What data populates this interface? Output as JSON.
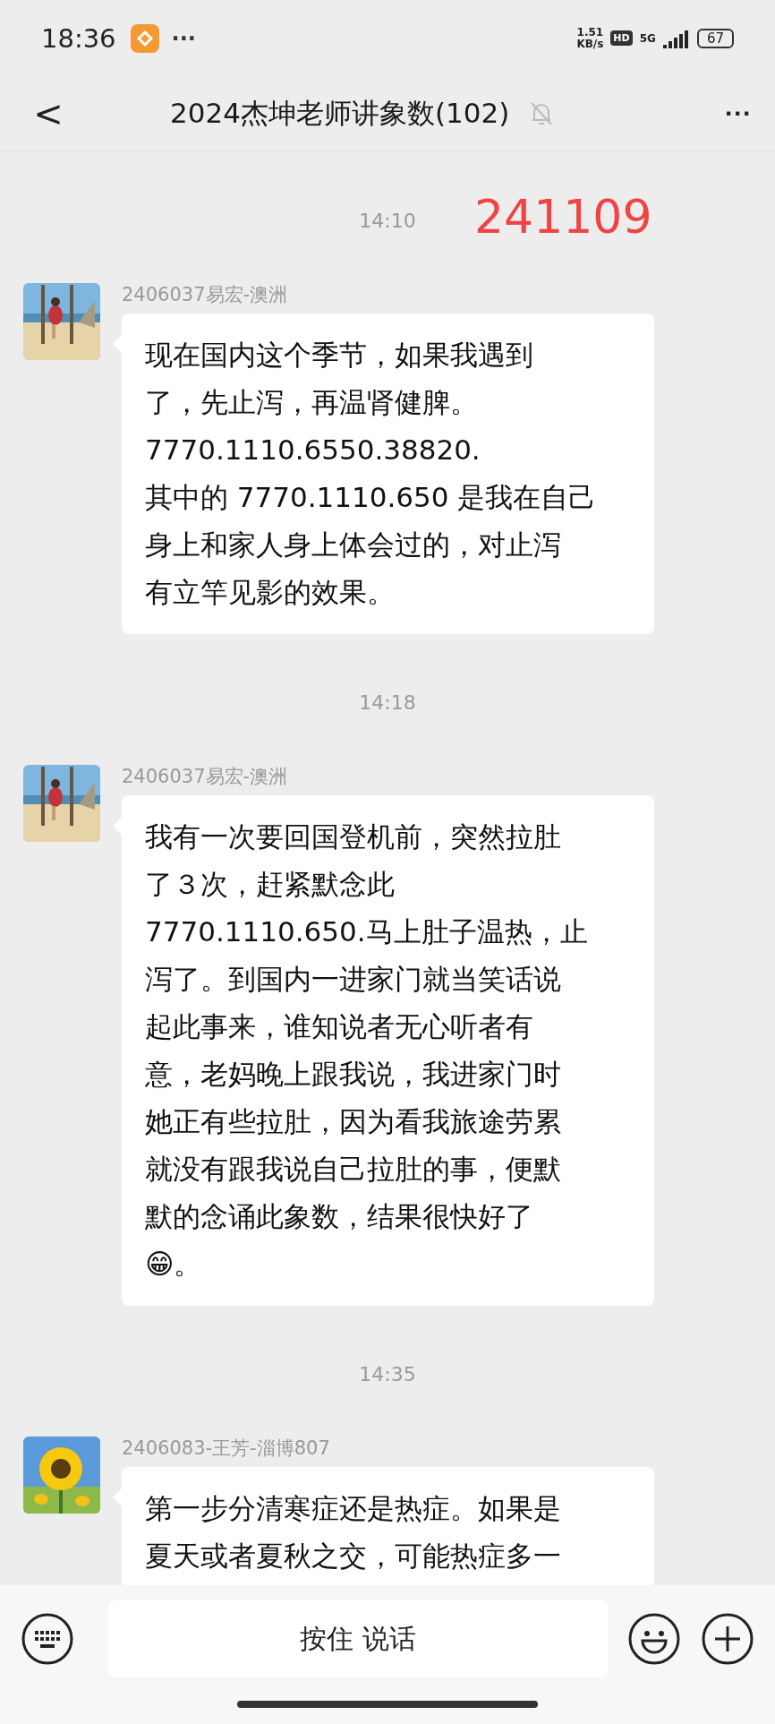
{
  "status_bar": {
    "time": "18:36",
    "more": "···",
    "speed_value": "1.51",
    "speed_unit": "KB/s",
    "hd": "HD",
    "network": "5G",
    "battery": "67"
  },
  "header": {
    "back": "<",
    "title": "2024杰坤老师讲象数(102)",
    "muted": true,
    "menu": "···"
  },
  "feed": [
    {
      "kind": "time",
      "time": "14:10",
      "note": "241109"
    },
    {
      "kind": "message",
      "sender": "2406037易宏-澳洲",
      "lines": [
        "现在国内这个季节，如果我遇到",
        "了，先止泻，再温肾健脾。",
        "7770.1110.6550.38820.",
        "其中的 7770.1110.650 是我在自己",
        "身上和家人身上体会过的，对止泻",
        "有立竿见影的效果。"
      ]
    },
    {
      "kind": "time",
      "time": "14:18"
    },
    {
      "kind": "message",
      "sender": "2406037易宏-澳洲",
      "lines": [
        "我有一次要回国登机前，突然拉肚",
        "了３次，赶紧默念此",
        "7770.1110.650.马上肚子温热，止",
        "泻了。到国内一进家门就当笑话说",
        "起此事来，谁知说者无心听者有",
        "意，老妈晚上跟我说，我进家门时",
        "她正有些拉肚，因为看我旅途劳累",
        "就没有跟我说自己拉肚的事，便默",
        "默的念诵此象数，结果很快好了",
        "😁。"
      ]
    },
    {
      "kind": "time",
      "time": "14:35"
    },
    {
      "kind": "message",
      "sender": "2406083-王芳-淄博807",
      "lines": [
        "第一步分清寒症还是热症。如果是",
        "夏天或者夏秋之交，可能热症多一"
      ]
    }
  ],
  "input_bar": {
    "voice_button": "按住 说话"
  }
}
